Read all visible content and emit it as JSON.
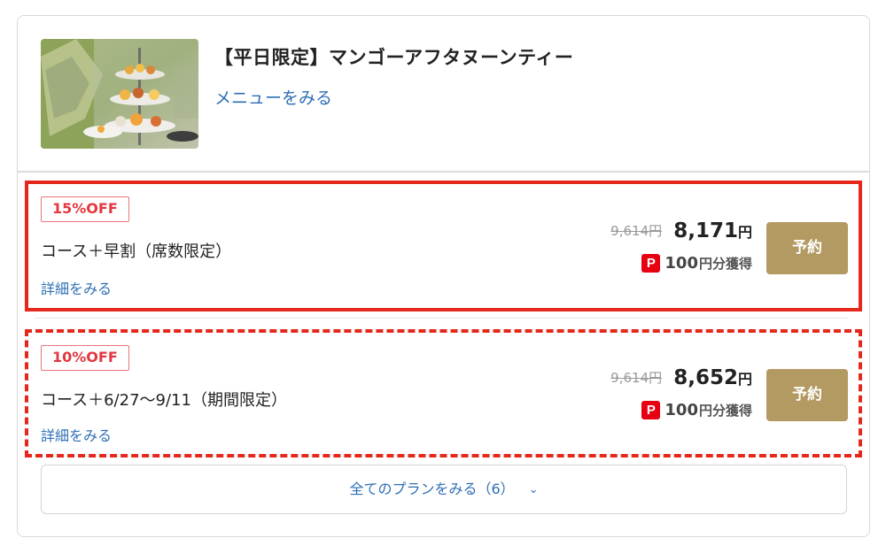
{
  "course": {
    "title": "【平日限定】マンゴーアフタヌーンティー",
    "menu_link": "メニューをみる"
  },
  "plans": [
    {
      "badge": "15%OFF",
      "name": "コース＋早割（席数限定）",
      "detail_link": "詳細をみる",
      "original_price": "9,614円",
      "price": "8,171",
      "price_unit": "円",
      "points_icon": "P",
      "points_value": "100",
      "points_label": "円分獲得",
      "reserve_label": "予約"
    },
    {
      "badge": "10%OFF",
      "name": "コース＋6/27〜9/11（期間限定）",
      "detail_link": "詳細をみる",
      "original_price": "9,614円",
      "price": "8,652",
      "price_unit": "円",
      "points_icon": "P",
      "points_value": "100",
      "points_label": "円分獲得",
      "reserve_label": "予約"
    }
  ],
  "all_plans_label": "全てのプランをみる（6）",
  "colors": {
    "accent_link": "#2f6fb5",
    "reserve_button": "#b39a62",
    "badge_text": "#e3373f",
    "highlight_border": "#e5281b",
    "paypay_red": "#e60012"
  },
  "icons": {
    "points": "paypay-icon",
    "expand": "chevron-down-icon"
  }
}
